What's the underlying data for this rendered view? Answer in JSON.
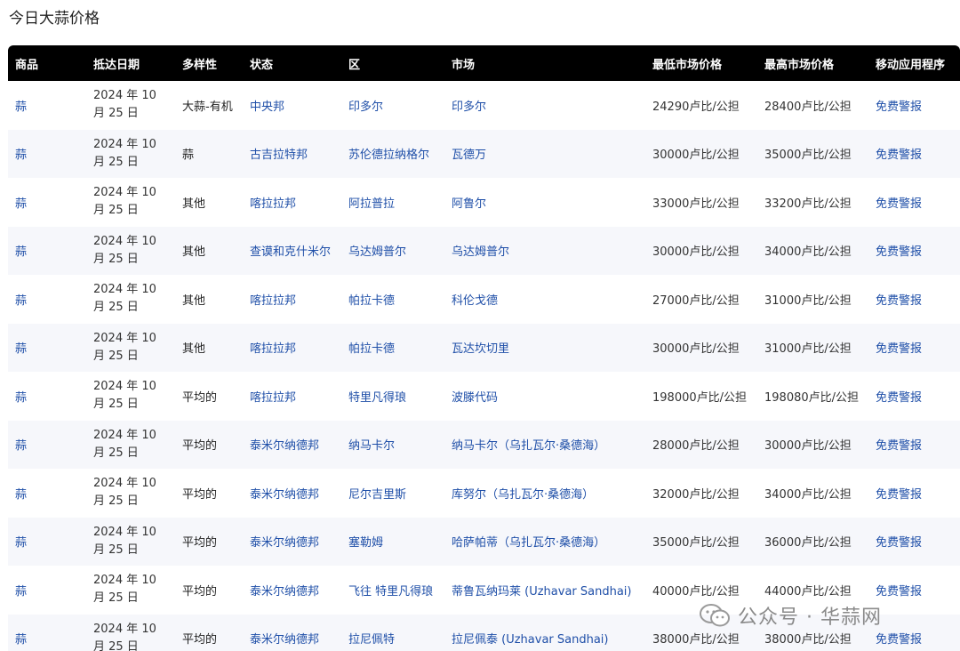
{
  "page_title": "今日大蒜价格",
  "table": {
    "headers": [
      "商品",
      "抵达日期",
      "多样性",
      "状态",
      "区",
      "市场",
      "最低市场价格",
      "最高市场价格",
      "移动应用程序"
    ],
    "rows": [
      [
        "蒜",
        "2024 年 10 月 25 日",
        "大蒜-有机",
        "中央邦",
        "印多尔",
        "印多尔",
        "24290卢比/公担",
        "28400卢比/公担",
        "免费警报"
      ],
      [
        "蒜",
        "2024 年 10 月 25 日",
        "蒜",
        "古吉拉特邦",
        "苏伦德拉纳格尔",
        "瓦德万",
        "30000卢比/公担",
        "35000卢比/公担",
        "免费警报"
      ],
      [
        "蒜",
        "2024 年 10 月 25 日",
        "其他",
        "喀拉拉邦",
        "阿拉普拉",
        "阿鲁尔",
        "33000卢比/公担",
        "33200卢比/公担",
        "免费警报"
      ],
      [
        "蒜",
        "2024 年 10 月 25 日",
        "其他",
        "查谟和克什米尔",
        "乌达姆普尔",
        "乌达姆普尔",
        "30000卢比/公担",
        "34000卢比/公担",
        "免费警报"
      ],
      [
        "蒜",
        "2024 年 10 月 25 日",
        "其他",
        "喀拉拉邦",
        "帕拉卡德",
        "科伦戈德",
        "27000卢比/公担",
        "31000卢比/公担",
        "免费警报"
      ],
      [
        "蒜",
        "2024 年 10 月 25 日",
        "其他",
        "喀拉拉邦",
        "帕拉卡德",
        "瓦达坎切里",
        "30000卢比/公担",
        "31000卢比/公担",
        "免费警报"
      ],
      [
        "蒜",
        "2024 年 10 月 25 日",
        "平均的",
        "喀拉拉邦",
        "特里凡得琅",
        "波滕代码",
        "198000卢比/公担",
        "198080卢比/公担",
        "免费警报"
      ],
      [
        "蒜",
        "2024 年 10 月 25 日",
        "平均的",
        "泰米尔纳德邦",
        "纳马卡尔",
        "纳马卡尔（乌扎瓦尔·桑德海）",
        "28000卢比/公担",
        "30000卢比/公担",
        "免费警报"
      ],
      [
        "蒜",
        "2024 年 10 月 25 日",
        "平均的",
        "泰米尔纳德邦",
        "尼尔吉里斯",
        "库努尔（乌扎瓦尔·桑德海）",
        "32000卢比/公担",
        "34000卢比/公担",
        "免费警报"
      ],
      [
        "蒜",
        "2024 年 10 月 25 日",
        "平均的",
        "泰米尔纳德邦",
        "塞勒姆",
        "哈萨帕蒂（乌扎瓦尔·桑德海）",
        "35000卢比/公担",
        "36000卢比/公担",
        "免费警报"
      ],
      [
        "蒜",
        "2024 年 10 月 25 日",
        "平均的",
        "泰米尔纳德邦",
        "飞往 特里凡得琅",
        "蒂鲁瓦纳玛莱 (Uzhavar Sandhai)",
        "40000卢比/公担",
        "44000卢比/公担",
        "免费警报"
      ],
      [
        "蒜",
        "2024 年 10 月 25 日",
        "平均的",
        "泰米尔纳德邦",
        "拉尼佩特",
        "拉尼佩泰 (Uzhavar Sandhai)",
        "38000卢比/公担",
        "38000卢比/公担",
        "免费警报"
      ]
    ]
  },
  "watermark": {
    "text": "公众号 · 华蒜网",
    "icon": "wechat-icon"
  },
  "colors": {
    "header_bg": "#000000",
    "link": "#1f4fa8",
    "stripe": "#f6f7fb"
  }
}
